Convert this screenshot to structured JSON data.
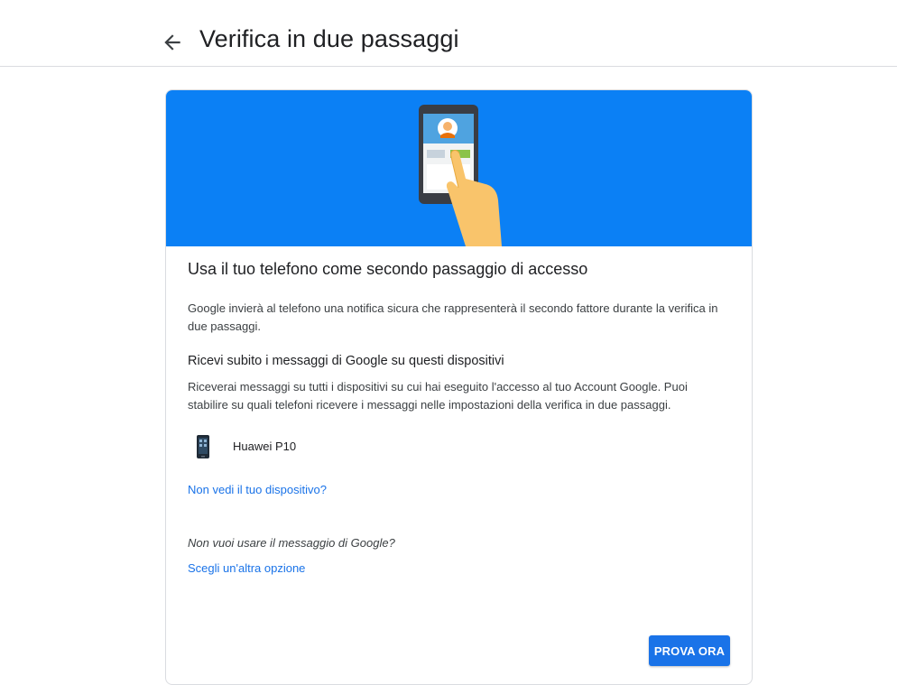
{
  "header": {
    "title": "Verifica in due passaggi",
    "back_icon": "arrow-left-icon"
  },
  "card": {
    "hero_icons": [
      "phone-illustration",
      "hand-illustration"
    ],
    "heading": "Usa il tuo telefono come secondo passaggio di accesso",
    "intro": "Google invierà al telefono una notifica sicura che rappresenterà il secondo fattore durante la verifica in due passaggi.",
    "devices_section": {
      "heading": "Ricevi subito i messaggi di Google su questi dispositivi",
      "text": "Riceverai messaggi su tutti i dispositivi su cui hai eseguito l'accesso al tuo Account Google. Puoi stabilire su quali telefoni ricevere i messaggi nelle impostazioni della verifica in due passaggi."
    },
    "devices": [
      {
        "name": "Huawei P10",
        "icon": "smartphone-icon"
      }
    ],
    "missing_device_link": "Non vedi il tuo dispositivo?",
    "alt_question": "Non vuoi usare il messaggio di Google?",
    "alt_option_link": "Scegli un'altra opzione",
    "primary_button": "PROVA ORA"
  },
  "colors": {
    "hero_background": "#0b80f5",
    "link": "#1a73e8",
    "button": "#1a73e8"
  }
}
